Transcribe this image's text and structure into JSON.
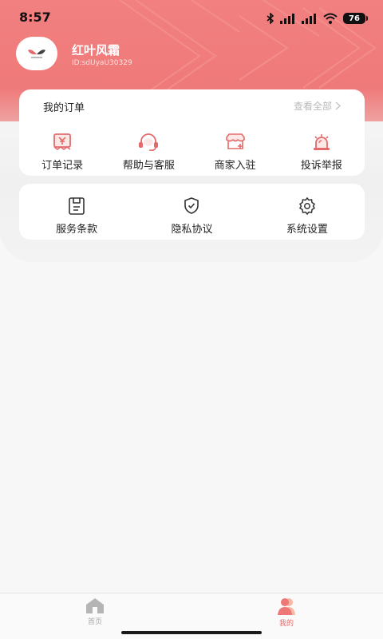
{
  "status_bar": {
    "time": "8:57",
    "battery": "76"
  },
  "profile": {
    "name": "红叶风霜",
    "id": "ID:sdUyaU30329"
  },
  "orders": {
    "title": "我的订单",
    "view_all": "查看全部",
    "items": [
      {
        "label": "订单记录",
        "icon": "receipt-icon"
      },
      {
        "label": "帮助与客服",
        "icon": "headset-icon"
      },
      {
        "label": "商家入驻",
        "icon": "shop-icon"
      },
      {
        "label": "投诉举报",
        "icon": "alarm-icon"
      }
    ]
  },
  "services": {
    "items": [
      {
        "label": "服务条款",
        "icon": "document-icon"
      },
      {
        "label": "隐私协议",
        "icon": "shield-icon"
      },
      {
        "label": "系统设置",
        "icon": "gear-icon"
      }
    ]
  },
  "tabbar": {
    "items": [
      {
        "label": "首页",
        "icon": "home-icon",
        "active": false
      },
      {
        "label": "我的",
        "icon": "user-icon",
        "active": true
      }
    ]
  },
  "colors": {
    "accent": "#EE7777",
    "icon": "#E46A6A",
    "text": "#222222",
    "muted": "#B9B9B9"
  }
}
